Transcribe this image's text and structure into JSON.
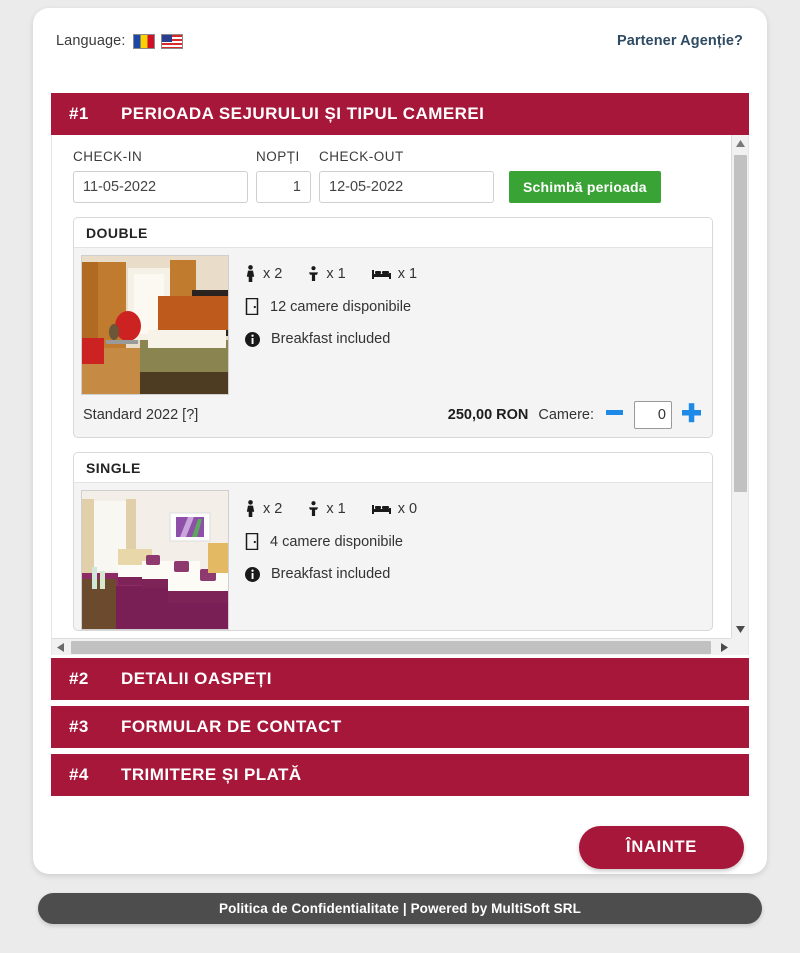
{
  "topbar": {
    "language_label": "Language:",
    "flags": [
      {
        "name": "flag-romania",
        "title": "Română"
      },
      {
        "name": "flag-usa",
        "title": "English"
      }
    ],
    "partner_link": "Partener Agenție?"
  },
  "sections": [
    {
      "num": "#1",
      "title": "PERIOADA SEJURULUI ȘI TIPUL CAMEREI"
    },
    {
      "num": "#2",
      "title": "DETALII OASPEȚI"
    },
    {
      "num": "#3",
      "title": "FORMULAR DE CONTACT"
    },
    {
      "num": "#4",
      "title": "TRIMITERE ȘI PLATĂ"
    }
  ],
  "dates": {
    "checkin_label": "CHECK-IN",
    "checkin_value": "11-05-2022",
    "nights_label": "NOPȚI",
    "nights_value": "1",
    "checkout_label": "CHECK-OUT",
    "checkout_value": "12-05-2022",
    "change_button": "Schimbă perioada"
  },
  "rooms": [
    {
      "type": "DOUBLE",
      "adults": "x 2",
      "children": "x 1",
      "beds": "x 1",
      "availability": "12 camere disponibile",
      "info": "Breakfast included",
      "rate_name": "Standard 2022 [?]",
      "price": "250,00 RON",
      "camere_label": "Camere:",
      "quantity": "0"
    },
    {
      "type": "SINGLE",
      "adults": "x 2",
      "children": "x 1",
      "beds": "x 0",
      "availability": "4 camere disponibile",
      "info": "Breakfast included",
      "rate_name": "",
      "price": "",
      "camere_label": "",
      "quantity": ""
    }
  ],
  "next_button": "ÎNAINTE",
  "footer": {
    "privacy": "Politica de Confidentialitate",
    "separator": " | ",
    "powered": "Powered by MultiSoft SRL"
  },
  "colors": {
    "brand_red": "#a6173a",
    "green": "#3aa335",
    "stepper_blue": "#1e8ae8",
    "footer_gray": "#4d4d4d",
    "page_bg": "#ebebeb"
  }
}
